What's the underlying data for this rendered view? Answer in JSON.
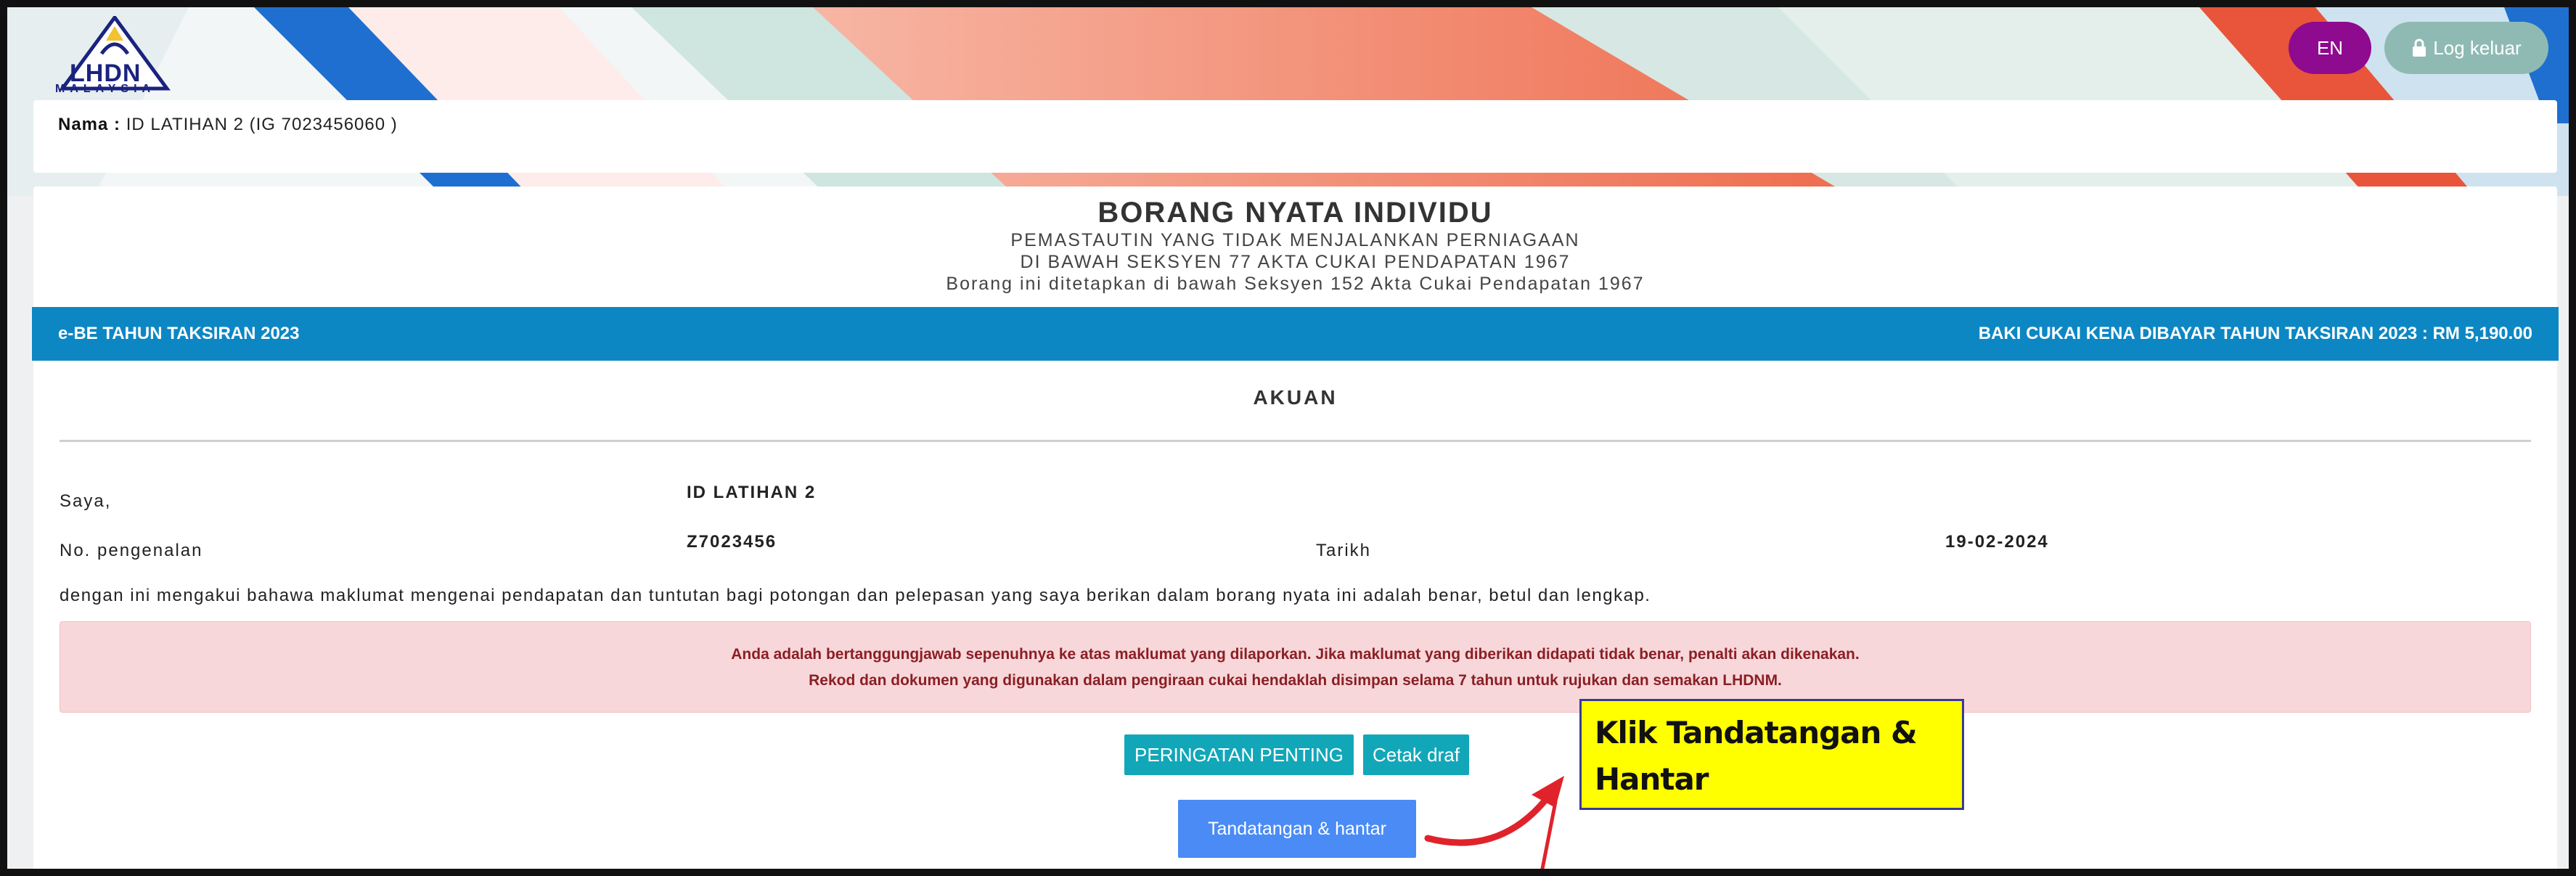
{
  "logo": {
    "line1": "LHDN",
    "line2": "MALAYSIA"
  },
  "header": {
    "language_button": "EN",
    "logout_label": "Log keluar"
  },
  "taxpayer": {
    "name_label": "Nama :",
    "name_value": "ID LATIHAN 2 (IG 7023456060 )"
  },
  "form": {
    "title": "BORANG NYATA INDIVIDU",
    "subtitle1": "PEMASTAUTIN YANG TIDAK MENJALANKAN PERNIAGAAN",
    "subtitle2": "DI BAWAH SEKSYEN 77 AKTA CUKAI PENDAPATAN 1967",
    "subtitle3": "Borang ini ditetapkan di bawah Seksyen 152 Akta Cukai Pendapatan 1967"
  },
  "bar": {
    "left": "e-BE TAHUN TAKSIRAN 2023",
    "right": "BAKI CUKAI KENA DIBAYAR TAHUN TAKSIRAN 2023 : RM 5,190.00"
  },
  "akuan": {
    "title": "AKUAN",
    "saya_label": "Saya,",
    "saya_value": "ID LATIHAN 2",
    "id_label": "No. pengenalan",
    "id_value": "Z7023456",
    "date_label": "Tarikh",
    "date_value": "19-02-2024",
    "declaration": "dengan ini mengakui bahawa maklumat mengenai pendapatan dan tuntutan bagi potongan dan pelepasan yang saya berikan dalam borang nyata ini adalah benar, betul dan lengkap."
  },
  "alert": {
    "line1": "Anda adalah bertanggungjawab sepenuhnya ke atas maklumat yang dilaporkan. Jika maklumat yang diberikan didapati tidak benar, penalti akan dikenakan.",
    "line2": "Rekod dan dokumen yang digunakan dalam pengiraan cukai hendaklah disimpan selama 7 tahun untuk rujukan dan semakan LHDNM."
  },
  "buttons": {
    "important": "PERINGATAN PENTING",
    "print_draft": "Cetak draf",
    "sign_submit": "Tandatangan & hantar"
  },
  "annotation": {
    "line1": "Klik Tandatangan &",
    "line2": "Hantar"
  },
  "colors": {
    "bar_blue": "#0d87c4",
    "en_button": "#8e0a8e",
    "logout_button": "#8fbab3",
    "teal_button": "#12a7b8",
    "submit_button": "#4a8bf5",
    "alert_bg": "#f8d7da",
    "callout_yellow": "#ffff00",
    "arrow_red": "#e0232b"
  }
}
